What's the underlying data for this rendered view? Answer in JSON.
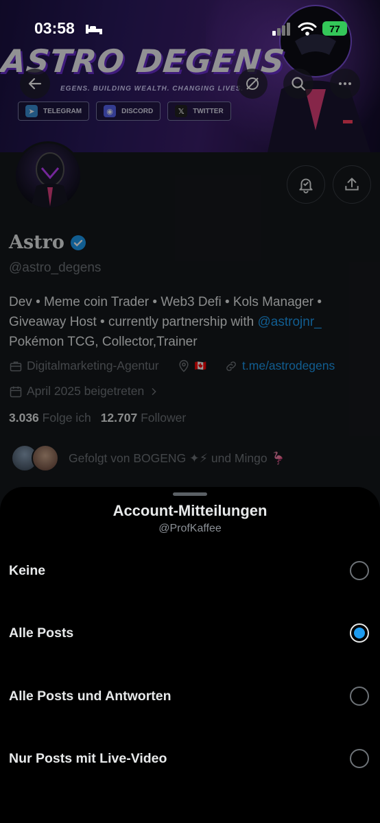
{
  "status_bar": {
    "time": "03:58",
    "battery": "77"
  },
  "banner": {
    "title": "ASTRO DEGENS",
    "tagline": "EGENS. BUILDING WEALTH. CHANGING LIVES.",
    "chips": [
      "TELEGRAM",
      "DISCORD",
      "TWITTER"
    ]
  },
  "profile": {
    "name": "Astro",
    "handle": "@astro_degens",
    "bio_line1": "Dev • Meme coin Trader • Web3 Defi • Kols Manager •",
    "bio_line2_text": "Giveaway Host • currently partnership with ",
    "bio_mention": "@astrojnr_",
    "bio_line3": "Pokémon TCG, Collector,Trainer",
    "category": "Digitalmarketing-Agentur",
    "location_flag": "🇨🇦",
    "link": "t.me/astrodegens",
    "joined": "April 2025 beigetreten",
    "following_count": "3.036",
    "following_label": "Folge ich",
    "followers_count": "12.707",
    "followers_label": "Follower",
    "followed_by": "Gefolgt von BOGENG ✦⚡ und Mingo 🦩"
  },
  "sheet": {
    "title": "Account-Mitteilungen",
    "subtitle": "@ProfKaffee",
    "options": [
      {
        "label": "Keine",
        "selected": false
      },
      {
        "label": "Alle Posts",
        "selected": true
      },
      {
        "label": "Alle Posts und Antworten",
        "selected": false
      },
      {
        "label": "Nur Posts mit Live-Video",
        "selected": false
      }
    ]
  },
  "colors": {
    "accent": "#1d9bf0",
    "sheet_bg": "#000000",
    "profile_bg": "#15181c",
    "battery": "#34c759"
  },
  "icons": [
    "back-arrow-icon",
    "hide-reposts-icon",
    "search-icon",
    "more-icon",
    "notification-bell-icon",
    "share-icon",
    "verified-badge-icon",
    "briefcase-icon",
    "location-icon",
    "link-icon",
    "calendar-icon",
    "chevron-right-icon"
  ]
}
